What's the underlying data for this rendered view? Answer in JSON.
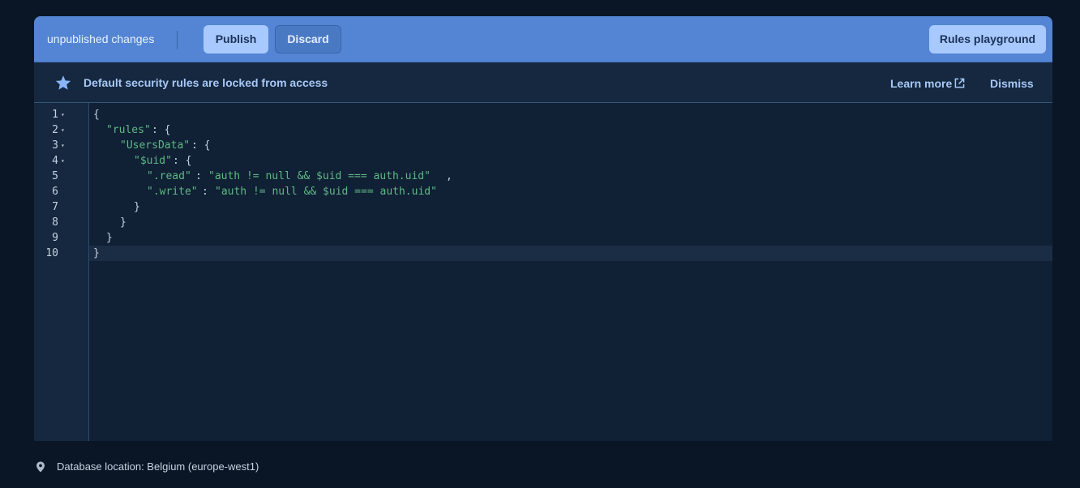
{
  "toolbar": {
    "status": "unpublished changes",
    "publish_label": "Publish",
    "discard_label": "Discard",
    "playground_label": "Rules playground"
  },
  "banner": {
    "icon": "star-icon",
    "message": "Default security rules are locked from access",
    "learn_more_label": "Learn more",
    "learn_more_icon": "external-link-icon",
    "dismiss_label": "Dismiss"
  },
  "editor": {
    "lines": [
      {
        "num": "1",
        "fold": "▾"
      },
      {
        "num": "2",
        "fold": "▾"
      },
      {
        "num": "3",
        "fold": "▾"
      },
      {
        "num": "4",
        "fold": "▾"
      },
      {
        "num": "5",
        "fold": ""
      },
      {
        "num": "6",
        "fold": ""
      },
      {
        "num": "7",
        "fold": ""
      },
      {
        "num": "8",
        "fold": ""
      },
      {
        "num": "9",
        "fold": ""
      },
      {
        "num": "10",
        "fold": ""
      }
    ],
    "code": {
      "l1_brace": "{",
      "l2_key": "\"rules\"",
      "l2_rest": ": {",
      "l3_key": "\"UsersData\"",
      "l3_rest": ": {",
      "l4_key": "\"$uid\"",
      "l4_rest": ": {",
      "l5_key": "\".read\"",
      "l5_colon": ":",
      "l5_val": "\"auth != null && $uid === auth.uid\"",
      "l5_comma": ",",
      "l6_key": "\".write\"",
      "l6_colon": ":",
      "l6_val": "\"auth != null && $uid === auth.uid\"",
      "l7_brace": "}",
      "l8_brace": "}",
      "l9_brace": "}",
      "l10_brace": "}"
    }
  },
  "footer": {
    "icon": "location-pin-icon",
    "location": "Database location: Belgium (europe-west1)"
  },
  "colors": {
    "toolbar": "#5485d4",
    "primary_button": "#a8c9fd",
    "banner_text": "#a7c8f7",
    "code_string": "#5fb984",
    "background": "#0a1625"
  }
}
